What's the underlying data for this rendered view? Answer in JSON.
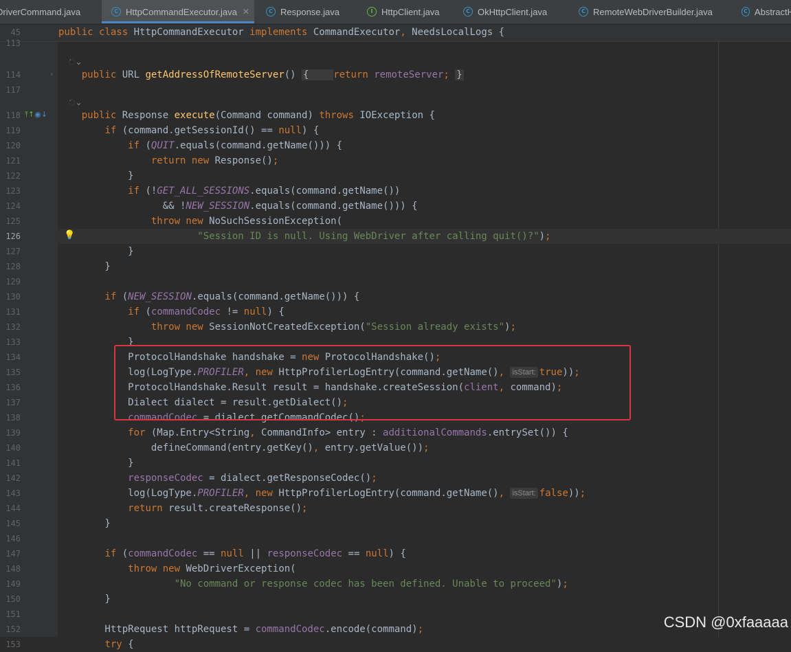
{
  "tabs": [
    {
      "label": "DriverCommand.java",
      "icon": "class-icon",
      "kind": "C",
      "active": false,
      "close": false
    },
    {
      "label": "HttpCommandExecutor.java",
      "icon": "class-icon",
      "kind": "C",
      "active": true,
      "close": true
    },
    {
      "label": "Response.java",
      "icon": "class-icon",
      "kind": "C",
      "active": false,
      "close": false
    },
    {
      "label": "HttpClient.java",
      "icon": "interface-icon",
      "kind": "I",
      "active": false,
      "close": false
    },
    {
      "label": "OkHttpClient.java",
      "icon": "class-icon",
      "kind": "C",
      "active": false,
      "close": false
    },
    {
      "label": "RemoteWebDriverBuilder.java",
      "icon": "class-icon",
      "kind": "C",
      "active": false,
      "close": false
    },
    {
      "label": "AbstractH",
      "icon": "class-icon",
      "kind": "C",
      "active": false,
      "close": false
    }
  ],
  "tab_close_glyph": "✕",
  "sticky": {
    "line": "45",
    "tokens": [
      [
        "kw",
        "public class "
      ],
      [
        "",
        "HttpCommandExecutor "
      ],
      [
        "kw",
        "implements "
      ],
      [
        "",
        "CommandExecutor"
      ],
      [
        "kw",
        ", "
      ],
      [
        "",
        "NeedsLocalLogs {"
      ]
    ]
  },
  "code_lines": [
    {
      "n": "113",
      "tokens": []
    },
    {
      "n": "",
      "anno": "ᨗ⌄",
      "tokens": []
    },
    {
      "n": "114",
      "fold": "›",
      "tokens": [
        [
          "",
          "    "
        ],
        [
          "kw",
          "public "
        ],
        [
          "",
          "URL "
        ],
        [
          "fn",
          "getAddressOfRemoteServer"
        ],
        [
          "",
          "() "
        ],
        [
          "box",
          "{    "
        ],
        [
          "kw",
          "return "
        ],
        [
          "fld",
          "remoteServer"
        ],
        [
          "kw",
          "; "
        ],
        [
          "box",
          "}"
        ]
      ]
    },
    {
      "n": "117",
      "tokens": []
    },
    {
      "n": "",
      "anno": "ᨗ⌄",
      "tokens": []
    },
    {
      "n": "118",
      "gicons": true,
      "tokens": [
        [
          "",
          "    "
        ],
        [
          "kw",
          "public "
        ],
        [
          "",
          "Response "
        ],
        [
          "fn",
          "execute"
        ],
        [
          "",
          "(Command command) "
        ],
        [
          "kw",
          "throws "
        ],
        [
          "",
          "IOException {"
        ]
      ]
    },
    {
      "n": "119",
      "tokens": [
        [
          "",
          "        "
        ],
        [
          "kw",
          "if "
        ],
        [
          "",
          "(command.getSessionId() == "
        ],
        [
          "kw",
          "null"
        ],
        [
          "",
          ") {"
        ]
      ]
    },
    {
      "n": "120",
      "tokens": [
        [
          "",
          "            "
        ],
        [
          "kw",
          "if "
        ],
        [
          "",
          "("
        ],
        [
          "sfi",
          "QUIT"
        ],
        [
          "",
          ".equals(command.getName())) {"
        ]
      ]
    },
    {
      "n": "121",
      "tokens": [
        [
          "",
          "                "
        ],
        [
          "kw",
          "return new "
        ],
        [
          "",
          "Response()"
        ],
        [
          "kw",
          ";"
        ]
      ]
    },
    {
      "n": "122",
      "tokens": [
        [
          "",
          "            }"
        ]
      ]
    },
    {
      "n": "123",
      "tokens": [
        [
          "",
          "            "
        ],
        [
          "kw",
          "if "
        ],
        [
          "",
          "(!"
        ],
        [
          "sfi",
          "GET_ALL_SESSIONS"
        ],
        [
          "",
          ".equals(command.getName())"
        ]
      ]
    },
    {
      "n": "124",
      "tokens": [
        [
          "",
          "                  && !"
        ],
        [
          "sfi",
          "NEW_SESSION"
        ],
        [
          "",
          ".equals(command.getName())) {"
        ]
      ]
    },
    {
      "n": "125",
      "tokens": [
        [
          "",
          "                "
        ],
        [
          "kw",
          "throw new "
        ],
        [
          "",
          "NoSuchSessionException("
        ]
      ]
    },
    {
      "n": "126",
      "current": true,
      "bulb": true,
      "tokens": [
        [
          "",
          "                        "
        ],
        [
          "str",
          "\"Session ID is null. Using WebDriver after calling quit()?\""
        ],
        [
          "",
          ")"
        ],
        [
          "kw",
          ";"
        ]
      ]
    },
    {
      "n": "127",
      "tokens": [
        [
          "",
          "            }"
        ]
      ]
    },
    {
      "n": "128",
      "tokens": [
        [
          "",
          "        }"
        ]
      ]
    },
    {
      "n": "129",
      "tokens": []
    },
    {
      "n": "130",
      "tokens": [
        [
          "",
          "        "
        ],
        [
          "kw",
          "if "
        ],
        [
          "",
          "("
        ],
        [
          "sfi",
          "NEW_SESSION"
        ],
        [
          "",
          ".equals(command.getName())) {"
        ]
      ]
    },
    {
      "n": "131",
      "tokens": [
        [
          "",
          "            "
        ],
        [
          "kw",
          "if "
        ],
        [
          "",
          "("
        ],
        [
          "fld",
          "commandCodec "
        ],
        [
          "",
          "!= "
        ],
        [
          "kw",
          "null"
        ],
        [
          "",
          ") {"
        ]
      ]
    },
    {
      "n": "132",
      "tokens": [
        [
          "",
          "                "
        ],
        [
          "kw",
          "throw new "
        ],
        [
          "",
          "SessionNotCreatedException("
        ],
        [
          "str",
          "\"Session already exists\""
        ],
        [
          "",
          ")"
        ],
        [
          "kw",
          ";"
        ]
      ]
    },
    {
      "n": "133",
      "tokens": [
        [
          "",
          "            }"
        ]
      ]
    },
    {
      "n": "134",
      "tokens": [
        [
          "",
          "            ProtocolHandshake handshake = "
        ],
        [
          "kw",
          "new "
        ],
        [
          "",
          "ProtocolHandshake()"
        ],
        [
          "kw",
          ";"
        ]
      ]
    },
    {
      "n": "135",
      "tokens": [
        [
          "",
          "            log(LogType."
        ],
        [
          "sfi",
          "PROFILER"
        ],
        [
          "kw",
          ", new "
        ],
        [
          "",
          "HttpProfilerLogEntry(command.getName()"
        ],
        [
          "kw",
          ", "
        ],
        [
          "hint",
          "isStart:"
        ],
        [
          "kw",
          "true"
        ],
        [
          "",
          "))"
        ],
        [
          "kw",
          ";"
        ]
      ]
    },
    {
      "n": "136",
      "tokens": [
        [
          "",
          "            ProtocolHandshake.Result result = handshake.createSession("
        ],
        [
          "fld",
          "client"
        ],
        [
          "kw",
          ", "
        ],
        [
          "",
          "command)"
        ],
        [
          "kw",
          ";"
        ]
      ]
    },
    {
      "n": "137",
      "tokens": [
        [
          "",
          "            Dialect dialect = result.getDialect()"
        ],
        [
          "kw",
          ";"
        ]
      ]
    },
    {
      "n": "138",
      "tokens": [
        [
          "",
          "            "
        ],
        [
          "fld",
          "commandCodec "
        ],
        [
          "",
          "= dialect.getCommandCodec()"
        ],
        [
          "kw",
          ";"
        ]
      ]
    },
    {
      "n": "139",
      "tokens": [
        [
          "",
          "            "
        ],
        [
          "kw",
          "for "
        ],
        [
          "",
          "(Map.Entry<String"
        ],
        [
          "kw",
          ", "
        ],
        [
          "",
          "CommandInfo> entry : "
        ],
        [
          "fld",
          "additionalCommands"
        ],
        [
          "",
          ".entrySet()) {"
        ]
      ]
    },
    {
      "n": "140",
      "tokens": [
        [
          "",
          "                defineCommand(entry.getKey()"
        ],
        [
          "kw",
          ", "
        ],
        [
          "",
          "entry.getValue())"
        ],
        [
          "kw",
          ";"
        ]
      ]
    },
    {
      "n": "141",
      "tokens": [
        [
          "",
          "            }"
        ]
      ]
    },
    {
      "n": "142",
      "tokens": [
        [
          "",
          "            "
        ],
        [
          "fld",
          "responseCodec "
        ],
        [
          "",
          "= dialect.getResponseCodec()"
        ],
        [
          "kw",
          ";"
        ]
      ]
    },
    {
      "n": "143",
      "tokens": [
        [
          "",
          "            log(LogType."
        ],
        [
          "sfi",
          "PROFILER"
        ],
        [
          "kw",
          ", new "
        ],
        [
          "",
          "HttpProfilerLogEntry(command.getName()"
        ],
        [
          "kw",
          ", "
        ],
        [
          "hint",
          "isStart:"
        ],
        [
          "kw",
          "false"
        ],
        [
          "",
          "))"
        ],
        [
          "kw",
          ";"
        ]
      ]
    },
    {
      "n": "144",
      "tokens": [
        [
          "",
          "            "
        ],
        [
          "kw",
          "return "
        ],
        [
          "",
          "result.createResponse()"
        ],
        [
          "kw",
          ";"
        ]
      ]
    },
    {
      "n": "145",
      "tokens": [
        [
          "",
          "        }"
        ]
      ]
    },
    {
      "n": "146",
      "tokens": []
    },
    {
      "n": "147",
      "tokens": [
        [
          "",
          "        "
        ],
        [
          "kw",
          "if "
        ],
        [
          "",
          "("
        ],
        [
          "fld",
          "commandCodec "
        ],
        [
          "",
          "== "
        ],
        [
          "kw",
          "null "
        ],
        [
          "",
          "|| "
        ],
        [
          "fld",
          "responseCodec "
        ],
        [
          "",
          "== "
        ],
        [
          "kw",
          "null"
        ],
        [
          "",
          ") {"
        ]
      ]
    },
    {
      "n": "148",
      "tokens": [
        [
          "",
          "            "
        ],
        [
          "kw",
          "throw new "
        ],
        [
          "",
          "WebDriverException("
        ]
      ]
    },
    {
      "n": "149",
      "tokens": [
        [
          "",
          "                    "
        ],
        [
          "str",
          "\"No command or response codec has been defined. Unable to proceed\""
        ],
        [
          "",
          ")"
        ],
        [
          "kw",
          ";"
        ]
      ]
    },
    {
      "n": "150",
      "tokens": [
        [
          "",
          "        }"
        ]
      ]
    },
    {
      "n": "151",
      "tokens": []
    },
    {
      "n": "152",
      "tokens": [
        [
          "",
          "        HttpRequest httpRequest = "
        ],
        [
          "fld",
          "commandCodec"
        ],
        [
          "",
          ".encode(command)"
        ],
        [
          "kw",
          ";"
        ]
      ]
    },
    {
      "n": "153",
      "tokens": [
        [
          "",
          "        "
        ],
        [
          "kw",
          "try "
        ],
        [
          "",
          "{"
        ]
      ]
    }
  ],
  "gutter_icons": {
    "first": "⤒↑",
    "second": "◉↓"
  },
  "bulb_glyph": "💡",
  "watermark": "CSDN @0xfaaaaa"
}
